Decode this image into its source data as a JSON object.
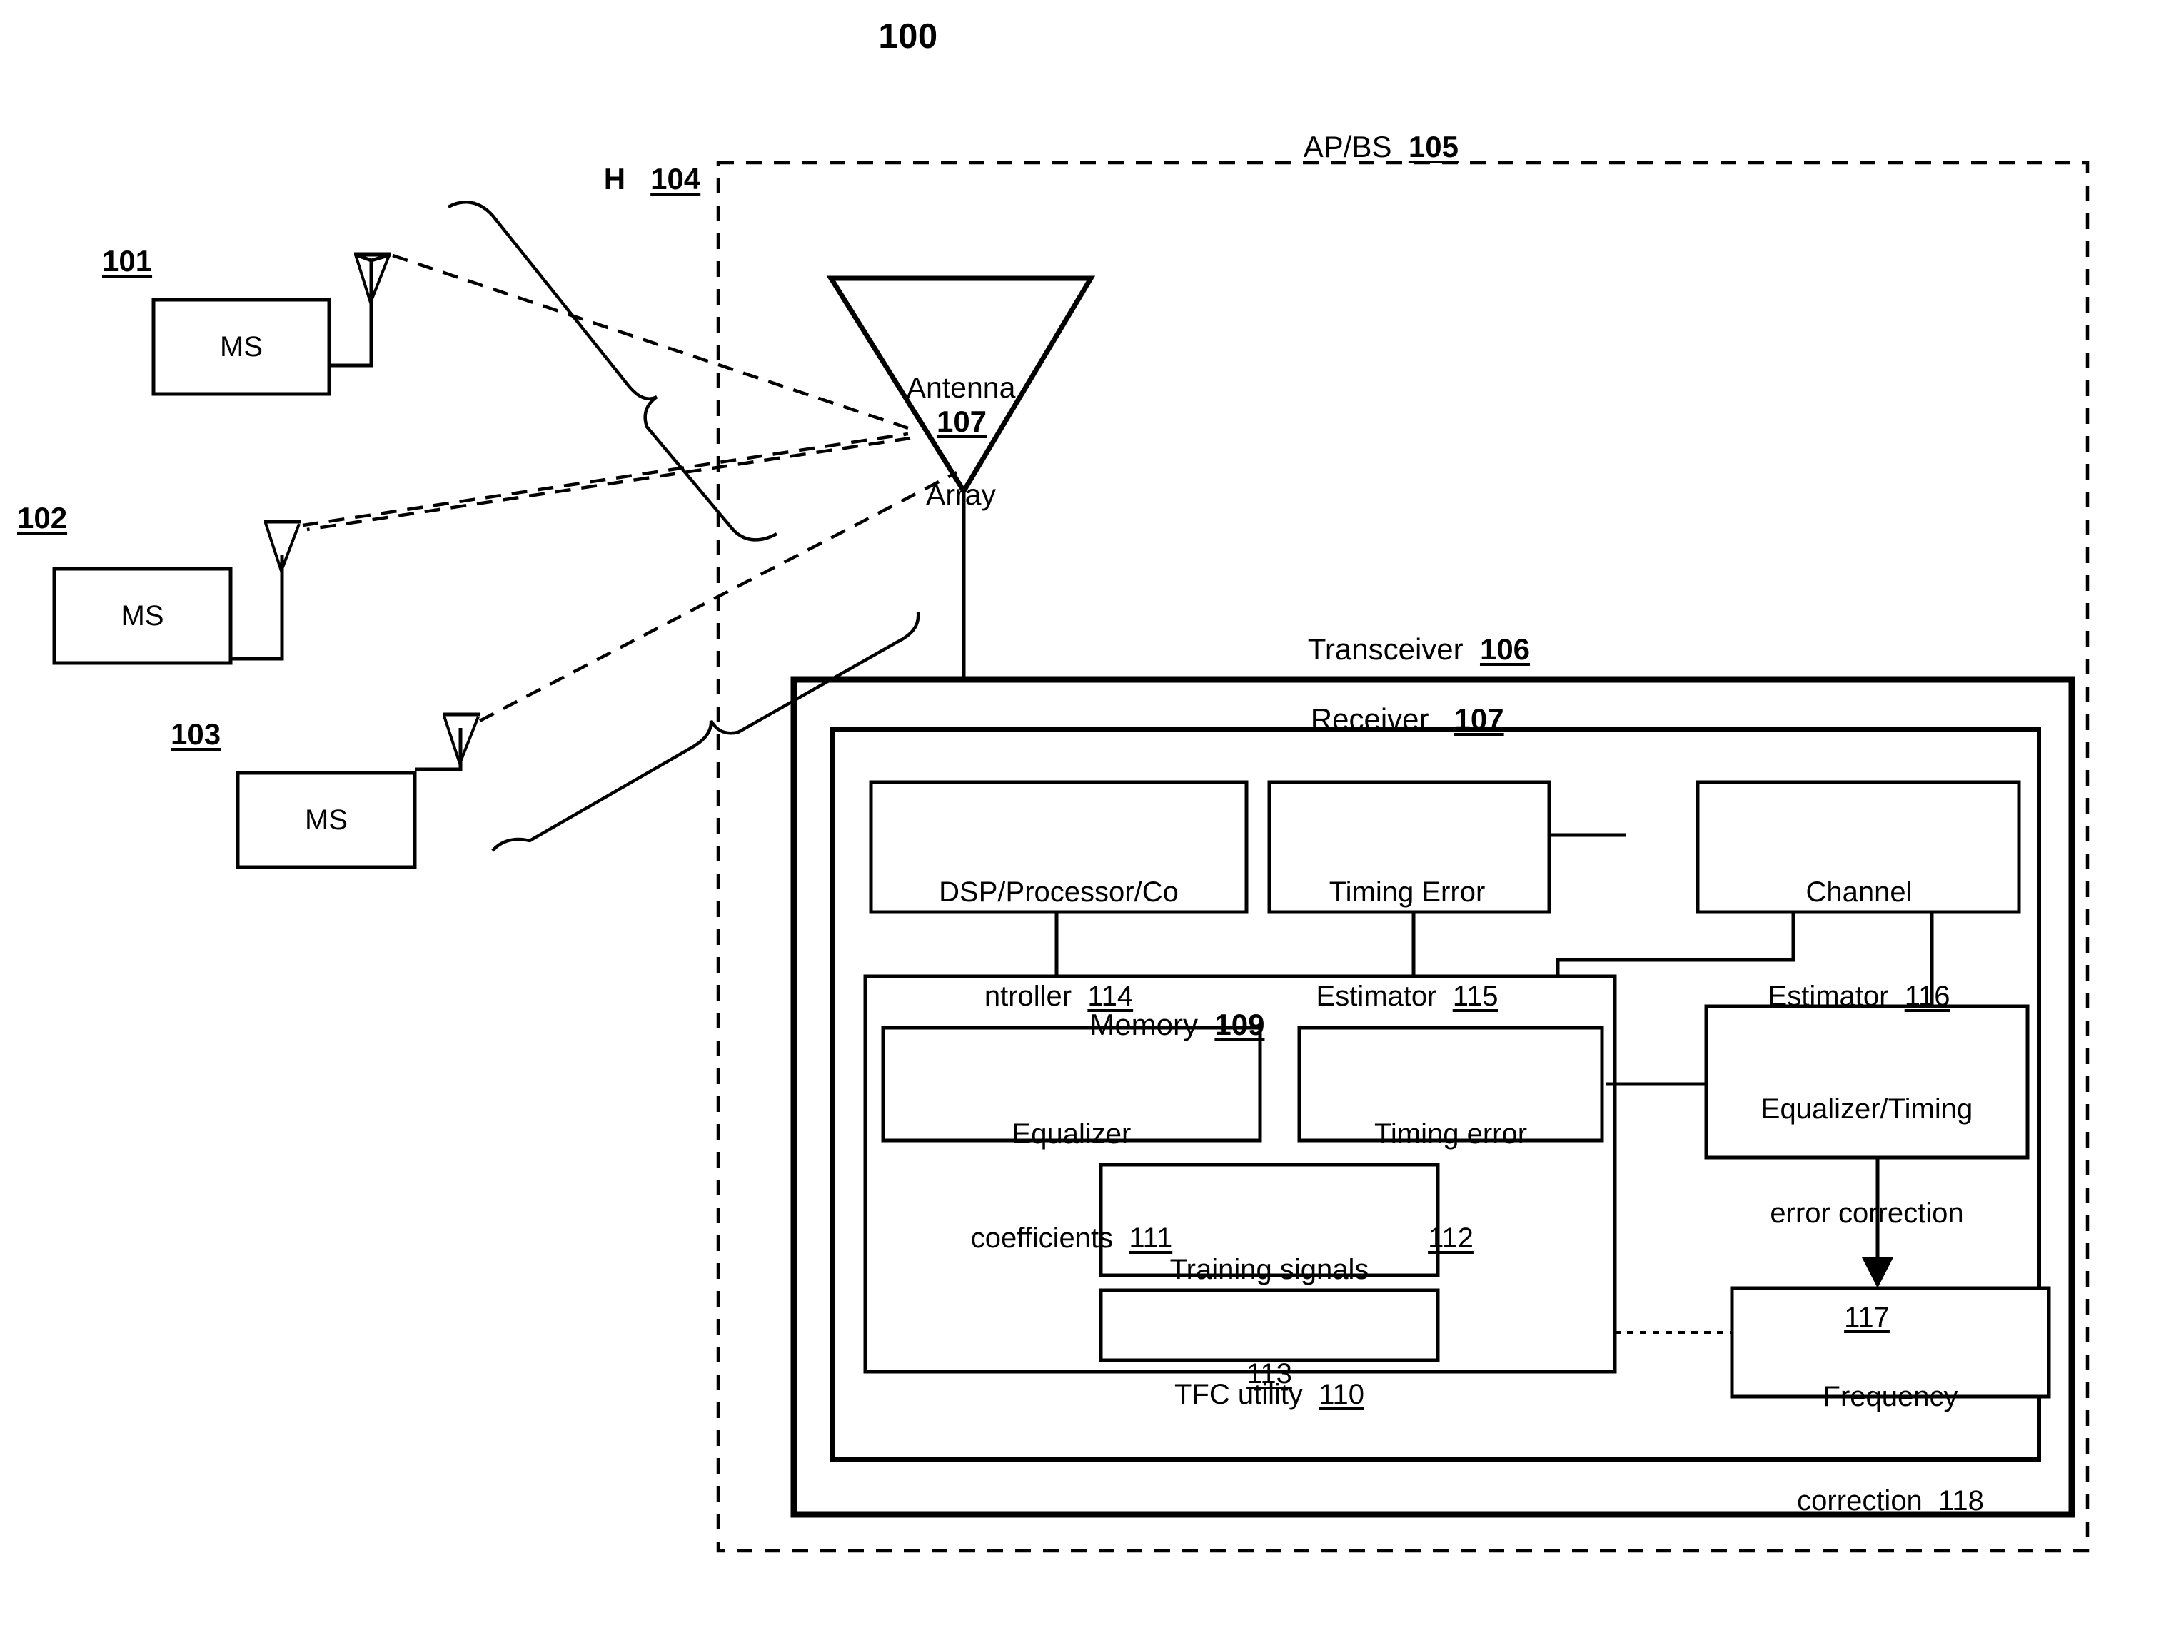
{
  "figure": {
    "number": "100"
  },
  "network": {
    "ap_bs": {
      "label": "AP/BS",
      "ref": "105"
    },
    "channel": {
      "label": "H",
      "ref": "104"
    },
    "antenna_array": {
      "line1": "Antenna",
      "line2": "Array",
      "ref": "107"
    },
    "stations": [
      {
        "ref": "101",
        "label": "MS"
      },
      {
        "ref": "102",
        "label": "MS"
      },
      {
        "ref": "103",
        "label": "MS"
      }
    ]
  },
  "transceiver": {
    "label": "Transceiver",
    "ref": "106",
    "receiver": {
      "label": "Receiver",
      "ref": "107",
      "blocks": [
        {
          "name": "dsp",
          "line1": "DSP/Processor/Co",
          "line2": "ntroller",
          "ref": "114"
        },
        {
          "name": "timing-error-estimator",
          "line1": "Timing Error",
          "line2": "Estimator",
          "ref": "115"
        },
        {
          "name": "channel-estimator",
          "line1": "Channel",
          "line2": "Estimator",
          "ref": "116"
        },
        {
          "name": "equalizer-timing-error-correction",
          "line1": "Equalizer/Timing",
          "line2": "error correction",
          "ref": "117"
        },
        {
          "name": "frequency-correction",
          "line1": "Frequency",
          "line2": "correction",
          "ref": "118"
        }
      ],
      "memory": {
        "label": "Memory",
        "ref": "109",
        "items": [
          {
            "name": "equalizer-coefficients",
            "line1": "Equalizer",
            "line2": "coefficients",
            "ref": "111"
          },
          {
            "name": "timing-error",
            "line1": "Timing error",
            "line2": "",
            "ref": "112"
          },
          {
            "name": "training-signals",
            "line1": "Training signals",
            "line2": "",
            "ref": "113"
          },
          {
            "name": "tfc-utility",
            "line1": "TFC utility",
            "line2": "",
            "ref": "110"
          }
        ]
      }
    }
  },
  "style": {
    "line_color": "#000000",
    "background": "#ffffff"
  }
}
